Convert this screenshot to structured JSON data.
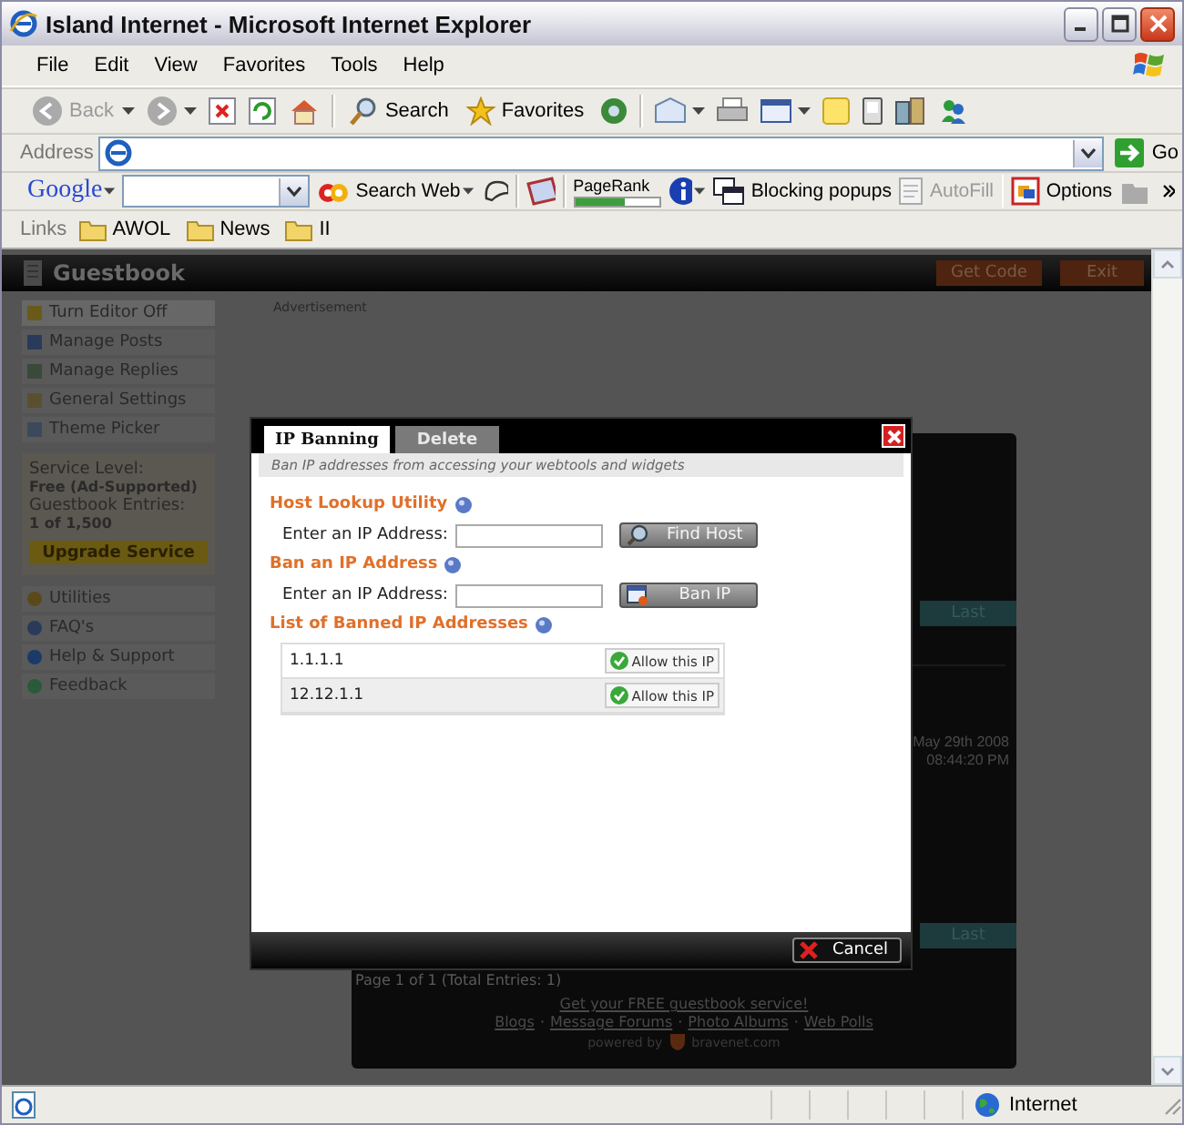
{
  "window": {
    "title": "Island Internet - Microsoft Internet Explorer"
  },
  "menu": [
    "File",
    "Edit",
    "View",
    "Favorites",
    "Tools",
    "Help"
  ],
  "toolbar": {
    "back": {
      "label": "Back",
      "disabled": true
    },
    "search": "Search",
    "favorites": "Favorites"
  },
  "address": {
    "label": "Address",
    "go": "Go"
  },
  "google": {
    "logo": "Google",
    "search_web": "Search Web",
    "pagerank": {
      "label": "PageRank",
      "level": 0.6
    },
    "blocking": "Blocking popups",
    "autofill": {
      "label": "AutoFill",
      "disabled": true
    },
    "options": "Options"
  },
  "links": {
    "label": "Links",
    "items": [
      "AWOL",
      "News",
      "II"
    ]
  },
  "app": {
    "title": "Guestbook",
    "buttons": [
      "Get Code",
      "Exit"
    ],
    "sidebar": [
      {
        "label": "Turn Editor Off",
        "selected": true
      },
      {
        "label": "Manage Posts",
        "selected": false
      },
      {
        "label": "Manage Replies",
        "selected": false
      },
      {
        "label": "General Settings",
        "selected": false
      },
      {
        "label": "Theme Picker",
        "selected": false
      }
    ],
    "service": {
      "level_label": "Service Level:",
      "level": "Free (Ad-Supported)",
      "entries_label": "Guestbook Entries:",
      "entries": "1 of 1,500",
      "upgrade": "Upgrade Service"
    },
    "sidebar2": [
      {
        "label": "Utilities"
      },
      {
        "label": "FAQ's"
      },
      {
        "label": "Help & Support"
      },
      {
        "label": "Feedback"
      }
    ],
    "advertisement": "Advertisement",
    "preview": {
      "last": [
        "Last",
        "Last"
      ],
      "date": "May 29th 2008",
      "time": "08:44:20 PM",
      "page_info": "Page 1 of 1 (Total Entries: 1)",
      "footer_title": "Get your FREE guestbook service!",
      "footer_links": [
        "Blogs",
        "Message Forums",
        "Photo Albums",
        "Web Polls"
      ],
      "separator": "·",
      "powered": "powered by",
      "powered_site": "bravenet.com"
    }
  },
  "dialog": {
    "tabs": [
      {
        "label": "IP Banning",
        "selected": true
      },
      {
        "label": "Delete",
        "selected": false
      }
    ],
    "subtitle": "Ban IP addresses from accessing your webtools and widgets",
    "sections": [
      {
        "title": "Host Lookup Utility",
        "label": "Enter an IP Address:",
        "button": "Find Host",
        "kind": "lookup"
      },
      {
        "title": "Ban an IP Address",
        "label": "Enter an IP Address:",
        "button": "Ban IP",
        "kind": "ban"
      }
    ],
    "list_title": "List of Banned IP Addresses",
    "banned": [
      {
        "ip": "1.1.1.1",
        "action": "Allow this IP"
      },
      {
        "ip": "12.12.1.1",
        "action": "Allow this IP"
      }
    ],
    "cancel": "Cancel"
  },
  "status_bar": {
    "zone": "Internet"
  }
}
